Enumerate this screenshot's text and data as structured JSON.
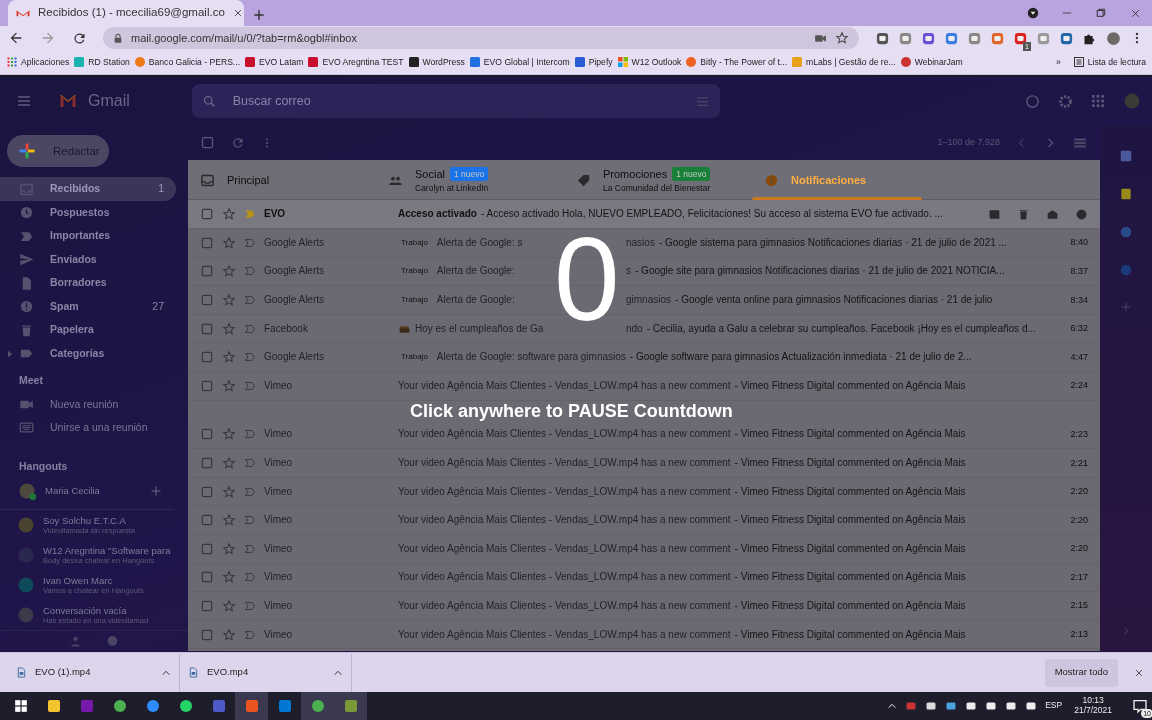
{
  "browser": {
    "tab_title": "Recibidos (1) - mcecilia69@gmail.co",
    "url": "mail.google.com/mail/u/0/?tab=rm&ogbl#inbox",
    "extension_badge": "1",
    "bookmarks": [
      "Aplicaciones",
      "RD Station",
      "Banco Galicia - PERS...",
      "EVO Latam",
      "EVO Aregntina TEST",
      "WordPress",
      "EVO Global | Intercom",
      "Pipefy",
      "W12 Outlook",
      "Bitly - The Power of t...",
      "mLabs | Gestão de re...",
      "WebinarJam"
    ],
    "more_bookmarks": "»",
    "reading_list": "Lista de lectura"
  },
  "gmail": {
    "product": "Gmail",
    "search_placeholder": "Buscar correo",
    "compose": "Redactar",
    "folders": [
      {
        "label": "Recibidos",
        "count": "1",
        "selected": true
      },
      {
        "label": "Pospuestos",
        "selected": false
      },
      {
        "label": "Importantes",
        "selected": false
      },
      {
        "label": "Enviados",
        "selected": false
      },
      {
        "label": "Borradores",
        "selected": false
      },
      {
        "label": "Spam",
        "count": "27",
        "selected": false
      },
      {
        "label": "Papelera",
        "selected": false
      },
      {
        "label": "Categorías",
        "selected": false,
        "expanded": false
      }
    ],
    "meet_title": "Meet",
    "meet_items": [
      "Nueva reunión",
      "Unirse a una reunión"
    ],
    "hangouts_title": "Hangouts",
    "hangouts_user": "Maria Cecilia",
    "chats": [
      {
        "name": "Soy Solchu E.T.C.A",
        "status": "Videollamada sin respuesta"
      },
      {
        "name": "W12 Aregntina \"Software para",
        "status": "Body desea chatear en Hangouts"
      },
      {
        "name": "Ivan Owen Marc",
        "status": "Vamos a chatear en Hangouts"
      },
      {
        "name": "Conversación vacía",
        "status": "Has estado en una videollamad"
      }
    ],
    "pagination": "1–100 de 7.928",
    "tabs": [
      {
        "label": "Principal",
        "selected": false
      },
      {
        "label": "Social",
        "badge": "1 nuevo",
        "color": "#1a73e8",
        "subtitle": "Carolyn at LinkedIn",
        "selected": false
      },
      {
        "label": "Promociones",
        "badge": "1 nuevo",
        "color": "#188038",
        "subtitle": "La Comunidad del Bienestar",
        "selected": false
      },
      {
        "label": "Notificaciones",
        "selected": true
      }
    ],
    "rows": [
      {
        "kind": "notice",
        "sender": "EVO",
        "subject": "Acceso activado",
        "snippet": "- Acceso activado Hola, NUEVO EMPLEADO, Felicitaciones! Su acceso al sistema EVO fue activado. ...",
        "unread": true,
        "important": true,
        "hovered": true
      },
      {
        "kind": "alert",
        "sender": "Google Alerts",
        "label": "Trabajo",
        "subject": "Alerta de Google: s",
        "subject_rest": "nasios",
        "snippet": "- Google sistema para gimnasios Notificaciones diarias · 21 de julio de 2021 ...",
        "time": "8:40",
        "unread": false,
        "important": false,
        "hovered": false
      },
      {
        "kind": "alert",
        "sender": "Google Alerts",
        "label": "Trabajo",
        "subject": "Alerta de Google:",
        "subject_rest": "s",
        "snippet": "- Google site para gimnasios Notificaciones diarias · 21 de julio de 2021 NOTICIA...",
        "time": "8:37",
        "unread": false,
        "important": false,
        "hovered": false
      },
      {
        "kind": "alert",
        "sender": "Google Alerts",
        "label": "Trabajo",
        "subject": "Alerta de Google:",
        "subject_rest": "gimnasios",
        "snippet": "- Google venta online para gimnasios Notificaciones diarias · 21 de julio",
        "time": "8:34",
        "unread": false,
        "important": false,
        "hovered": false
      },
      {
        "kind": "birthday",
        "sender": "Facebook",
        "subject": "Hoy es el cumpleaños de Ga",
        "subject_rest": "ndo",
        "snippet": "- Cecilia, ayuda a Galu a celebrar su cumpleaños. Facebook ¡Hoy es el cumpleaños d...",
        "time": "6:32",
        "unread": false,
        "important": false,
        "hovered": false
      },
      {
        "kind": "alert",
        "sender": "Google Alerts",
        "label": "Trabajo",
        "subject": "Alerta de Google: software para gimnasios",
        "snippet": "- Google software para gimnasios Actualización inmediata · 21 de julio de 2...",
        "time": "4:47",
        "unread": false,
        "important": false,
        "hovered": false
      },
      {
        "kind": "comment",
        "sender": "Vimeo",
        "subject": "Your video Agência Mais Clientes - Vendas_LOW.mp4 has a new comment",
        "snippet": "- Vimeo Fitness Digital commented on Agência Mais",
        "time": "2:24",
        "unread": false,
        "important": false,
        "hovered": false
      },
      {
        "kind": "comment",
        "sender": "Vimeo",
        "subject": "Your video Agência Mais Clientes - Vendas_LOW.mp4 has a new comment",
        "snippet": "- Vimeo Fitness Digital commented on Agência Mais",
        "time": "2:23",
        "unread": false,
        "important": false,
        "hovered": false
      },
      {
        "kind": "comment",
        "sender": "Vimeo",
        "subject": "Your video Agência Mais Clientes - Vendas_LOW.mp4 has a new comment",
        "snippet": "- Vimeo Fitness Digital commented on Agência Mais",
        "time": "2:21",
        "unread": false,
        "important": false,
        "hovered": false
      },
      {
        "kind": "comment",
        "sender": "Vimeo",
        "subject": "Your video Agência Mais Clientes - Vendas_LOW.mp4 has a new comment",
        "snippet": "- Vimeo Fitness Digital commented on Agência Mais",
        "time": "2:20",
        "unread": false,
        "important": false,
        "hovered": false
      },
      {
        "kind": "comment",
        "sender": "Vimeo",
        "subject": "Your video Agência Mais Clientes - Vendas_LOW.mp4 has a new comment",
        "snippet": "- Vimeo Fitness Digital commented on Agência Mais",
        "time": "2:20",
        "unread": false,
        "important": false,
        "hovered": false
      },
      {
        "kind": "comment",
        "sender": "Vimeo",
        "subject": "Your video Agência Mais Clientes - Vendas_LOW.mp4 has a new comment",
        "snippet": "- Vimeo Fitness Digital commented on Agência Mais",
        "time": "2:20",
        "unread": false,
        "important": false,
        "hovered": false
      },
      {
        "kind": "comment",
        "sender": "Vimeo",
        "subject": "Your video Agência Mais Clientes - Vendas_LOW.mp4 has a new comment",
        "snippet": "- Vimeo Fitness Digital commented on Agência Mais",
        "time": "2:17",
        "unread": false,
        "important": false,
        "hovered": false
      },
      {
        "kind": "comment",
        "sender": "Vimeo",
        "subject": "Your video Agência Mais Clientes - Vendas_LOW.mp4 has a new comment",
        "snippet": "- Vimeo Fitness Digital commented on Agência Mais",
        "time": "2:15",
        "unread": false,
        "important": false,
        "hovered": false
      },
      {
        "kind": "comment",
        "sender": "Vimeo",
        "subject": "Your video Agência Mais Clientes - Vendas_LOW.mp4 has a new comment",
        "snippet": "- Vimeo Fitness Digital commented on Agência Mais",
        "time": "2:13",
        "unread": false,
        "important": false,
        "hovered": false
      }
    ]
  },
  "countdown": {
    "number": "0",
    "caption": "Click anywhere to PAUSE Countdown"
  },
  "downloads": {
    "files": [
      "EVO (1).mp4",
      "EVO.mp4"
    ],
    "show_all": "Mostrar todo"
  },
  "taskbar": {
    "language": "ESP",
    "time": "10:13",
    "date": "21/7/2021",
    "notifications": "10"
  }
}
